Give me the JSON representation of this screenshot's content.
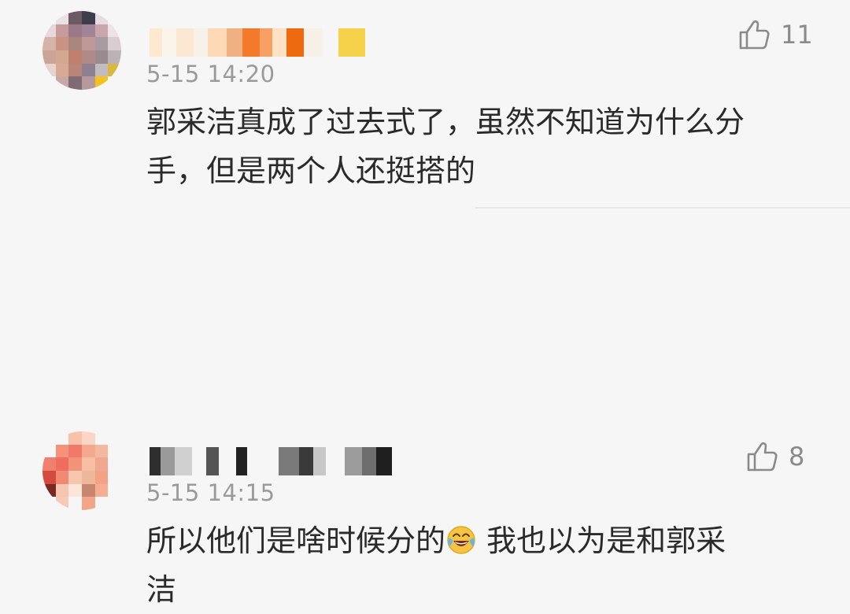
{
  "comments": [
    {
      "timestamp": "5-15 14:20",
      "likes": "11",
      "text_line1": "郭采洁真成了过去式了，虽然不知道为什么分",
      "text_line2": "手，但是两个人还挺搭的",
      "avatar_icon": "pixelated-avatar",
      "username_icon": "pixelated-username"
    },
    {
      "timestamp": "5-15 14:15",
      "likes": "8",
      "text_line1_before_emoji": "所以他们是啥时候分的",
      "emoji_icon": "laughing-tears-emoji",
      "text_line1_after_emoji": " 我也以为是和郭采",
      "text_line2": "洁",
      "avatar_icon": "pixelated-avatar",
      "username_icon": "pixelated-username"
    }
  ],
  "colors": {
    "background": "#f6f6f6",
    "text": "#2a2a2a",
    "meta": "#9a9a9a",
    "like_icon": "#8a8a8a"
  }
}
